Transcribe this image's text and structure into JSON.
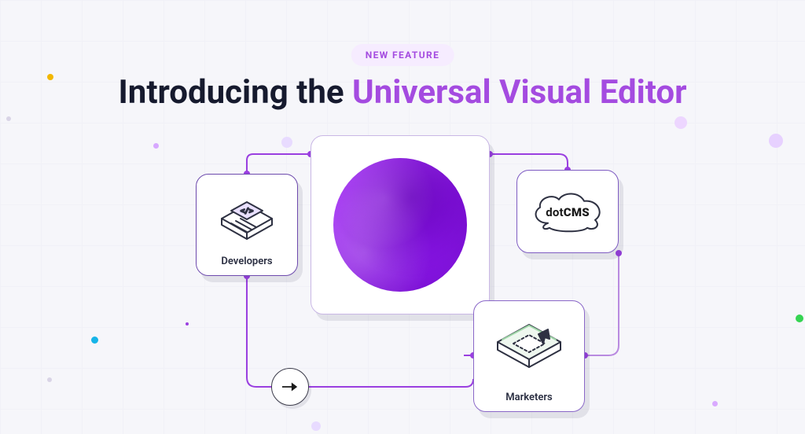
{
  "badge": "NEW FEATURE",
  "headline_prefix": "Introducing the ",
  "headline_accent": "Universal Visual Editor",
  "cards": {
    "developers": {
      "label": "Developers"
    },
    "marketers": {
      "label": "Marketers"
    },
    "dotcms_prefix": "dot",
    "dotcms_bold": "CMS"
  },
  "colors": {
    "accent": "#a44be0",
    "wire": "#9a3fe0"
  }
}
